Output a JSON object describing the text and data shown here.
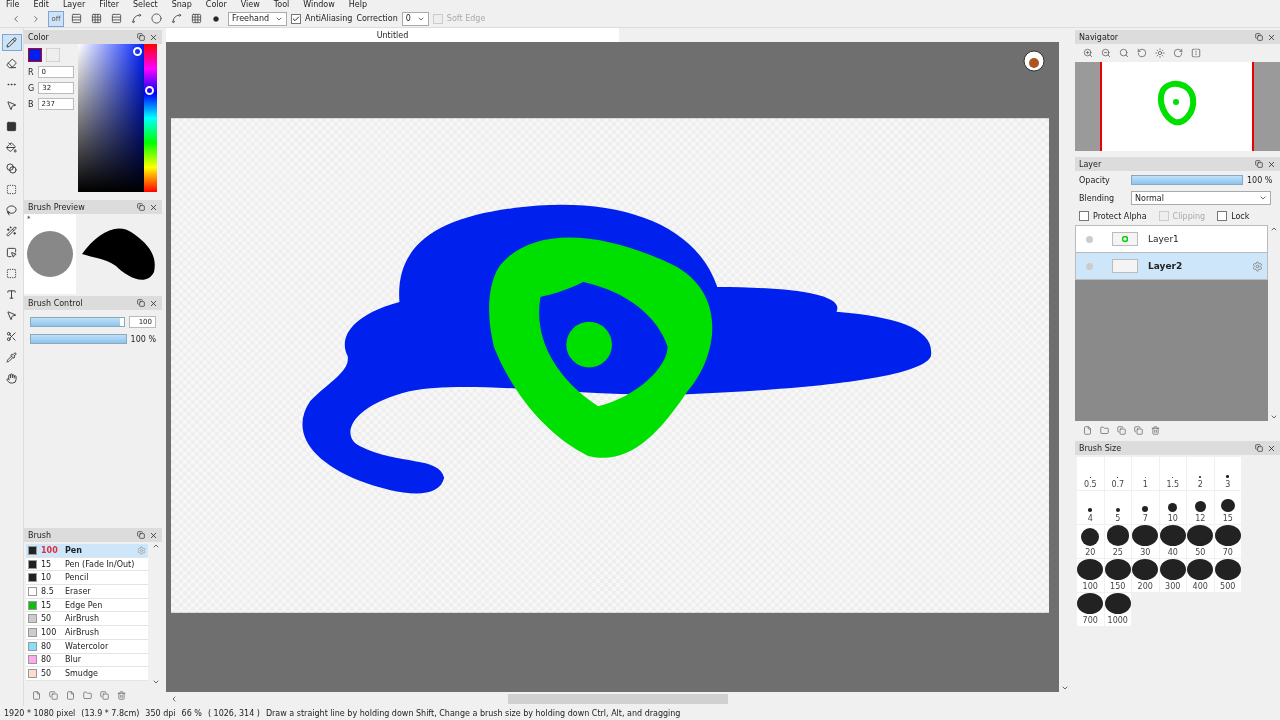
{
  "menu": [
    "File",
    "Edit",
    "Layer",
    "Filter",
    "Select",
    "Snap",
    "Color",
    "View",
    "Tool",
    "Window",
    "Help"
  ],
  "toolbar": {
    "snap_off": {
      "label": "off",
      "selected": true
    },
    "mode": "Freehand",
    "antialiasing": {
      "label": "AntiAliasing",
      "checked": true
    },
    "correction": {
      "label": "Correction",
      "value": "0"
    },
    "soft_edge": {
      "label": "Soft Edge",
      "checked": false,
      "disabled": true
    }
  },
  "toolbox": [
    {
      "kind": "pen",
      "selected": true
    },
    {
      "kind": "eraser",
      "selected": false
    },
    {
      "kind": "dots",
      "selected": false
    },
    {
      "kind": "move",
      "selected": false
    },
    {
      "kind": "fill",
      "selected": false
    },
    {
      "kind": "bucket",
      "selected": false
    },
    {
      "kind": "gradient",
      "selected": false
    },
    {
      "kind": "select",
      "selected": false
    },
    {
      "kind": "lasso",
      "selected": false
    },
    {
      "kind": "wand",
      "selected": false
    },
    {
      "kind": "selpen",
      "selected": false
    },
    {
      "kind": "selerase",
      "selected": false
    },
    {
      "kind": "text",
      "selected": false
    },
    {
      "kind": "operation",
      "selected": false
    },
    {
      "kind": "divide",
      "selected": false
    },
    {
      "kind": "eyedropper",
      "selected": false
    },
    {
      "kind": "hand",
      "selected": false
    }
  ],
  "color_panel": {
    "title": "Color",
    "color": "#0020ed",
    "hue": {
      "level": 0.7
    },
    "r": "0",
    "g": "32",
    "b": "237",
    "channel_labels": [
      "R",
      "G",
      "B"
    ]
  },
  "brush_preview": {
    "title": "Brush Preview",
    "mark": "*"
  },
  "brush_control": {
    "title": "Brush Control",
    "size": {
      "value": "100",
      "level": 0.96
    },
    "opacity": {
      "level": 1,
      "reading": "100 %"
    }
  },
  "brush_panel": {
    "title": "Brush",
    "items": [
      {
        "size": "100",
        "name": "Pen",
        "color": "#222222",
        "selected": true
      },
      {
        "size": "15",
        "name": "Pen (Fade In/Out)",
        "color": "#222222",
        "selected": false
      },
      {
        "size": "10",
        "name": "Pencil",
        "color": "#222222",
        "selected": false
      },
      {
        "size": "8.5",
        "name": "Eraser",
        "color": "#ffffff",
        "selected": false
      },
      {
        "size": "15",
        "name": "Edge Pen",
        "color": "#11bb11",
        "selected": false
      },
      {
        "size": "50",
        "name": "AirBrush",
        "color": "#cccccc",
        "selected": false
      },
      {
        "size": "100",
        "name": "AirBrush",
        "color": "#cccccc",
        "selected": false
      },
      {
        "size": "80",
        "name": "Watercolor",
        "color": "#88ddf8",
        "selected": false
      },
      {
        "size": "80",
        "name": "Blur",
        "color": "#ffaaee",
        "selected": false
      },
      {
        "size": "50",
        "name": "Smudge",
        "color": "#ffddcc",
        "selected": false
      }
    ]
  },
  "document": {
    "title": "Untitled"
  },
  "navigator": {
    "title": "Navigator"
  },
  "layer_panel": {
    "title": "Layer",
    "opacity": {
      "label": "Opacity",
      "level": 1,
      "reading": "100 %"
    },
    "blending": {
      "label": "Blending",
      "value": "Normal"
    },
    "protect_alpha": {
      "label": "Protect Alpha",
      "checked": false
    },
    "clipping": {
      "label": "Clipping",
      "checked": false,
      "disabled": true
    },
    "lock": {
      "label": "Lock",
      "checked": false
    },
    "layers": [
      {
        "name": "Layer1",
        "selected": false
      },
      {
        "name": "Layer2",
        "selected": true
      }
    ]
  },
  "brush_size": {
    "title": "Brush Size",
    "sizes": [
      "0.5",
      "0.7",
      "1",
      "1.5",
      "2",
      "3",
      "4",
      "5",
      "7",
      "10",
      "12",
      "15",
      "20",
      "25",
      "30",
      "40",
      "50",
      "70",
      "100",
      "150",
      "200",
      "300",
      "400",
      "500",
      "700",
      "1000"
    ]
  },
  "status_bar": {
    "pixels": "1920 * 1080 pixel",
    "physical": "(13.9 * 7.8cm)",
    "dpi": "350 dpi",
    "zoom": "66 %",
    "cursor": "( 1026, 314 )",
    "hint": "Draw a straight line by holding down Shift, Change a brush size by holding down Ctrl, Alt, and dragging"
  }
}
